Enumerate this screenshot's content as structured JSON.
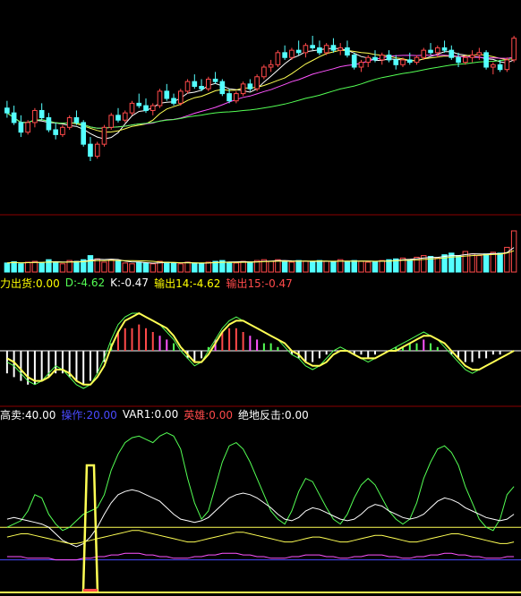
{
  "colors": {
    "bg": "#000000",
    "up": "#ff4a4a",
    "down": "#54ffff",
    "ma_white": "#ffffff",
    "ma_yellow": "#ffff54",
    "ma_magenta": "#ff54ff",
    "ma_green": "#54ff54",
    "divider": "#8b0000",
    "label_yellow": "#ffff00",
    "label_green": "#54ff54",
    "label_blue": "#4a4aff",
    "label_red": "#ff4a4a",
    "label_white": "#ffffff"
  },
  "indicator_rows": [
    {
      "items": [
        {
          "text": "力出货:0.00",
          "color": "#ffff00"
        },
        {
          "text": "D:-4.62",
          "color": "#54ff54"
        },
        {
          "text": "K:-0.47",
          "color": "#ffffff"
        },
        {
          "text": "输出14:-4.62",
          "color": "#ffff00"
        },
        {
          "text": "输出15:-0.47",
          "color": "#ff4a4a"
        }
      ]
    },
    {
      "items": [
        {
          "text": "高卖:40.00",
          "color": "#ffffff"
        },
        {
          "text": "操作:20.00",
          "color": "#4a4aff"
        },
        {
          "text": "VAR1:0.00",
          "color": "#ffffff"
        },
        {
          "text": "英雄:0.00",
          "color": "#ff4a4a"
        },
        {
          "text": "绝地反击:0.00",
          "color": "#ffffff"
        }
      ]
    }
  ],
  "chart_data": [
    {
      "type": "candlestick",
      "candles": [
        [
          52,
          55,
          48,
          50
        ],
        [
          50,
          53,
          45,
          46
        ],
        [
          46,
          49,
          40,
          42
        ],
        [
          42,
          47,
          41,
          46
        ],
        [
          46,
          52,
          44,
          51
        ],
        [
          51,
          54,
          47,
          48
        ],
        [
          48,
          50,
          42,
          43
        ],
        [
          43,
          46,
          39,
          41
        ],
        [
          41,
          45,
          40,
          44
        ],
        [
          44,
          49,
          43,
          48
        ],
        [
          48,
          51,
          45,
          46
        ],
        [
          46,
          47,
          36,
          37
        ],
        [
          37,
          40,
          30,
          32
        ],
        [
          32,
          38,
          31,
          37
        ],
        [
          37,
          45,
          36,
          44
        ],
        [
          44,
          50,
          43,
          49
        ],
        [
          49,
          52,
          46,
          47
        ],
        [
          47,
          51,
          46,
          50
        ],
        [
          50,
          55,
          49,
          54
        ],
        [
          54,
          58,
          52,
          53
        ],
        [
          53,
          56,
          50,
          51
        ],
        [
          51,
          54,
          49,
          53
        ],
        [
          53,
          60,
          52,
          59
        ],
        [
          59,
          62,
          55,
          56
        ],
        [
          56,
          58,
          53,
          54
        ],
        [
          54,
          60,
          53,
          59
        ],
        [
          59,
          64,
          58,
          63
        ],
        [
          63,
          66,
          60,
          61
        ],
        [
          61,
          64,
          59,
          60
        ],
        [
          60,
          65,
          59,
          64
        ],
        [
          64,
          67,
          62,
          63
        ],
        [
          63,
          64,
          57,
          58
        ],
        [
          58,
          60,
          54,
          55
        ],
        [
          55,
          59,
          54,
          58
        ],
        [
          58,
          63,
          57,
          62
        ],
        [
          62,
          64,
          59,
          60
        ],
        [
          60,
          66,
          59,
          65
        ],
        [
          65,
          70,
          64,
          69
        ],
        [
          69,
          72,
          67,
          70
        ],
        [
          70,
          76,
          69,
          75
        ],
        [
          75,
          78,
          72,
          73
        ],
        [
          73,
          77,
          72,
          76
        ],
        [
          76,
          80,
          74,
          75
        ],
        [
          75,
          79,
          73,
          78
        ],
        [
          78,
          82,
          76,
          77
        ],
        [
          77,
          80,
          74,
          75
        ],
        [
          75,
          79,
          74,
          78
        ],
        [
          78,
          81,
          75,
          76
        ],
        [
          76,
          79,
          74,
          77
        ],
        [
          77,
          80,
          73,
          74
        ],
        [
          74,
          75,
          68,
          69
        ],
        [
          69,
          72,
          67,
          71
        ],
        [
          71,
          74,
          69,
          73
        ],
        [
          73,
          76,
          71,
          72
        ],
        [
          72,
          75,
          70,
          74
        ],
        [
          74,
          76,
          71,
          72
        ],
        [
          72,
          74,
          68,
          70
        ],
        [
          70,
          73,
          69,
          72
        ],
        [
          72,
          75,
          70,
          71
        ],
        [
          71,
          74,
          70,
          73
        ],
        [
          73,
          77,
          72,
          76
        ],
        [
          76,
          79,
          74,
          75
        ],
        [
          75,
          78,
          73,
          77
        ],
        [
          77,
          80,
          75,
          76
        ],
        [
          76,
          78,
          72,
          73
        ],
        [
          73,
          75,
          69,
          71
        ],
        [
          71,
          74,
          70,
          73
        ],
        [
          73,
          76,
          71,
          74
        ],
        [
          74,
          77,
          72,
          75
        ],
        [
          75,
          76,
          68,
          69
        ],
        [
          69,
          71,
          66,
          70
        ],
        [
          70,
          72,
          67,
          68
        ],
        [
          68,
          73,
          67,
          72
        ],
        [
          72,
          82,
          71,
          81
        ]
      ],
      "volume": [
        0.22,
        0.25,
        0.2,
        0.24,
        0.26,
        0.22,
        0.3,
        0.24,
        0.2,
        0.28,
        0.26,
        0.3,
        0.4,
        0.32,
        0.24,
        0.3,
        0.26,
        0.22,
        0.2,
        0.24,
        0.22,
        0.2,
        0.26,
        0.24,
        0.22,
        0.2,
        0.24,
        0.22,
        0.2,
        0.24,
        0.26,
        0.28,
        0.24,
        0.22,
        0.26,
        0.24,
        0.28,
        0.3,
        0.26,
        0.3,
        0.26,
        0.24,
        0.28,
        0.26,
        0.24,
        0.28,
        0.26,
        0.24,
        0.3,
        0.26,
        0.28,
        0.26,
        0.24,
        0.26,
        0.28,
        0.3,
        0.32,
        0.34,
        0.3,
        0.36,
        0.4,
        0.38,
        0.34,
        0.42,
        0.46,
        0.4,
        0.5,
        0.44,
        0.4,
        0.44,
        0.48,
        0.46,
        0.6,
        1.0
      ]
    },
    {
      "type": "oscillator",
      "series": [
        {
          "values": [
            -3,
            -4,
            -6,
            -8,
            -9,
            -8,
            -6,
            -4,
            -5,
            -7,
            -9,
            -10,
            -9,
            -6,
            -2,
            3,
            7,
            9,
            10,
            10,
            9,
            8,
            7,
            5,
            3,
            0,
            -2,
            -4,
            -3,
            0,
            3,
            6,
            8,
            9,
            8,
            7,
            6,
            5,
            4,
            3,
            1,
            -1,
            -2,
            -4,
            -5,
            -4,
            -2,
            0,
            1,
            0,
            -1,
            -2,
            -3,
            -2,
            -1,
            0,
            1,
            2,
            3,
            4,
            5,
            4,
            3,
            1,
            -1,
            -3,
            -5,
            -6,
            -5,
            -4,
            -3,
            -2,
            -1,
            0
          ]
        },
        {
          "values": [
            -2,
            -3,
            -5,
            -7,
            -8,
            -8,
            -7,
            -5,
            -5,
            -6,
            -8,
            -9,
            -9,
            -7,
            -4,
            1,
            5,
            8,
            9,
            10,
            9,
            8,
            7,
            6,
            4,
            1,
            -1,
            -3,
            -3,
            -1,
            2,
            5,
            7,
            8,
            8,
            7,
            6,
            5,
            4,
            3,
            2,
            0,
            -1,
            -3,
            -4,
            -4,
            -3,
            -1,
            0,
            0,
            -1,
            -2,
            -2,
            -2,
            -1,
            0,
            0,
            1,
            2,
            3,
            4,
            4,
            3,
            2,
            0,
            -2,
            -4,
            -5,
            -5,
            -4,
            -3,
            -2,
            -1,
            0
          ]
        }
      ],
      "histogram": [
        -6,
        -7,
        -8,
        -9,
        -9,
        -8,
        -7,
        -6,
        -6,
        -7,
        -8,
        -9,
        -8,
        -6,
        -3,
        2,
        5,
        6,
        6,
        7,
        6,
        5,
        4,
        3,
        2,
        0,
        -2,
        -3,
        -2,
        1,
        3,
        5,
        6,
        6,
        5,
        4,
        3,
        2,
        2,
        1,
        0,
        -1,
        -2,
        -3,
        -3,
        -2,
        -1,
        0,
        0,
        0,
        -1,
        -1,
        -2,
        -1,
        0,
        0,
        1,
        1,
        2,
        2,
        3,
        2,
        1,
        0,
        -1,
        -2,
        -3,
        -3,
        -2,
        -2,
        -1,
        -1,
        0,
        0
      ]
    },
    {
      "type": "line",
      "series": [
        {
          "values": [
            40,
            42,
            44,
            50,
            60,
            58,
            48,
            42,
            38,
            40,
            44,
            48,
            50,
            52,
            60,
            75,
            85,
            92,
            95,
            96,
            94,
            92,
            96,
            98,
            96,
            88,
            70,
            55,
            45,
            50,
            65,
            80,
            90,
            92,
            88,
            80,
            70,
            60,
            50,
            45,
            42,
            50,
            62,
            70,
            68,
            60,
            52,
            45,
            42,
            48,
            58,
            66,
            70,
            66,
            58,
            50,
            45,
            42,
            45,
            55,
            70,
            80,
            88,
            90,
            86,
            78,
            65,
            55,
            45,
            40,
            38,
            45,
            60,
            65
          ]
        },
        {
          "values": [
            45,
            46,
            45,
            44,
            43,
            42,
            40,
            36,
            32,
            30,
            28,
            30,
            34,
            40,
            48,
            55,
            60,
            62,
            63,
            62,
            60,
            58,
            56,
            52,
            48,
            45,
            44,
            43,
            44,
            46,
            50,
            54,
            58,
            60,
            61,
            60,
            58,
            55,
            52,
            48,
            45,
            44,
            46,
            50,
            52,
            51,
            49,
            47,
            45,
            44,
            45,
            48,
            52,
            54,
            53,
            50,
            48,
            46,
            45,
            46,
            48,
            52,
            56,
            58,
            57,
            55,
            52,
            50,
            48,
            46,
            45,
            44,
            45,
            48
          ]
        },
        {
          "values": [
            34,
            35,
            36,
            36,
            35,
            34,
            33,
            32,
            31,
            30,
            30,
            31,
            32,
            33,
            34,
            35,
            36,
            37,
            38,
            38,
            37,
            36,
            35,
            34,
            33,
            32,
            31,
            31,
            32,
            33,
            34,
            35,
            36,
            37,
            37,
            36,
            35,
            34,
            33,
            32,
            31,
            31,
            32,
            33,
            34,
            34,
            33,
            32,
            31,
            31,
            32,
            33,
            34,
            35,
            35,
            34,
            33,
            32,
            31,
            31,
            32,
            33,
            34,
            35,
            36,
            36,
            35,
            34,
            33,
            32,
            31,
            30,
            30,
            31
          ]
        },
        {
          "values": [
            22,
            22,
            22,
            21,
            21,
            21,
            21,
            20,
            20,
            20,
            20,
            21,
            21,
            22,
            22,
            23,
            23,
            24,
            24,
            24,
            23,
            23,
            22,
            22,
            21,
            21,
            21,
            22,
            22,
            23,
            23,
            24,
            24,
            24,
            23,
            23,
            22,
            22,
            21,
            21,
            21,
            22,
            22,
            23,
            23,
            23,
            22,
            22,
            21,
            21,
            22,
            22,
            23,
            23,
            23,
            22,
            22,
            21,
            21,
            22,
            22,
            23,
            23,
            24,
            24,
            23,
            23,
            22,
            22,
            21,
            21,
            21,
            22,
            22
          ]
        }
      ],
      "reference_lines": [
        40,
        20
      ],
      "spike_index": 12
    }
  ]
}
